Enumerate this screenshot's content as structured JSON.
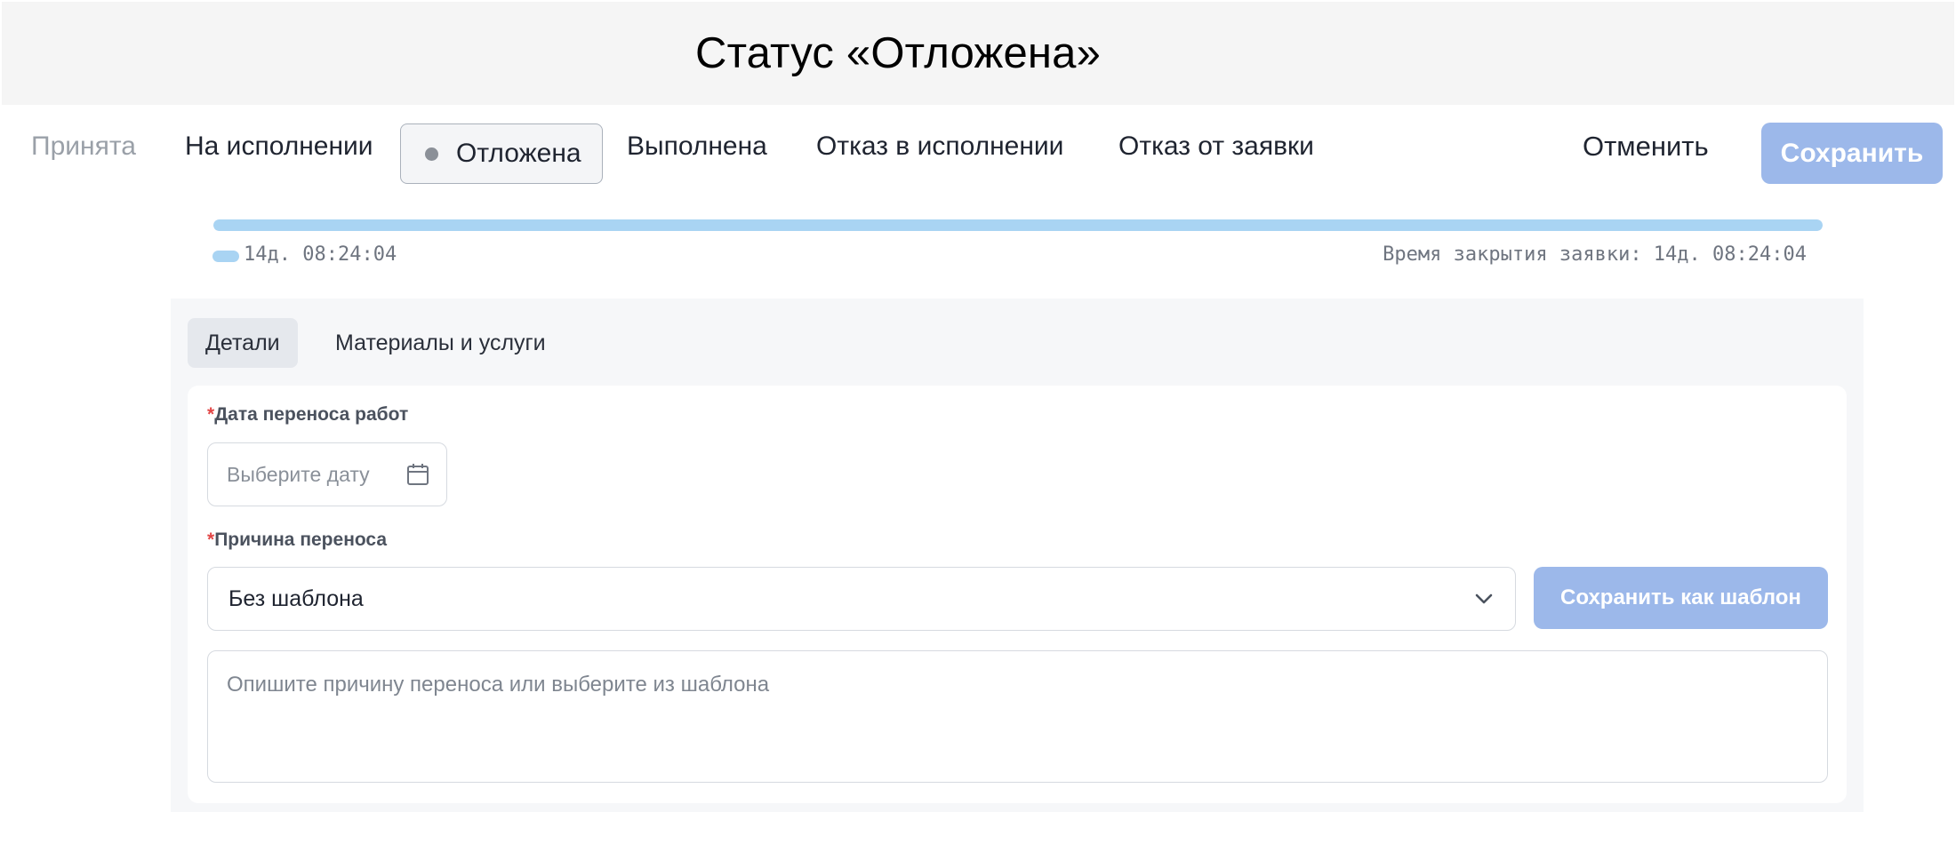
{
  "page": {
    "title": "Статус «Отложена»"
  },
  "status_bar": {
    "statuses": [
      {
        "label": "Принята",
        "state": "muted"
      },
      {
        "label": "На исполнении",
        "state": "default"
      },
      {
        "label": "Отложена",
        "state": "selected"
      },
      {
        "label": "Выполнена",
        "state": "default"
      },
      {
        "label": "Отказ в исполнении",
        "state": "default"
      },
      {
        "label": "Отказ от заявки",
        "state": "default"
      }
    ],
    "cancel_label": "Отменить",
    "save_label": "Сохранить"
  },
  "timer": {
    "elapsed": "14д. 08:24:04",
    "closing_time": "Время закрытия заявки: 14д. 08:24:04",
    "progress_percent": 100
  },
  "tabs": [
    {
      "label": "Детали",
      "active": true
    },
    {
      "label": "Материалы и услуги",
      "active": false
    }
  ],
  "form": {
    "date_field": {
      "required_mark": "*",
      "label": "Дата переноса работ",
      "placeholder": "Выберите дату",
      "value": ""
    },
    "reason_field": {
      "required_mark": "*",
      "label": "Причина переноса",
      "selected": "Без шаблона"
    },
    "save_template_label": "Сохранить как шаблон",
    "reason_text": {
      "placeholder": "Опишите причину переноса или выберите из шаблона",
      "value": ""
    }
  },
  "colors": {
    "accent_button": "#9cb8ea",
    "progress": "#a9d4f3",
    "required": "#e24646"
  },
  "icons": {
    "date": "calendar-icon",
    "select": "chevron-down-icon",
    "status": "status-dot-icon"
  }
}
